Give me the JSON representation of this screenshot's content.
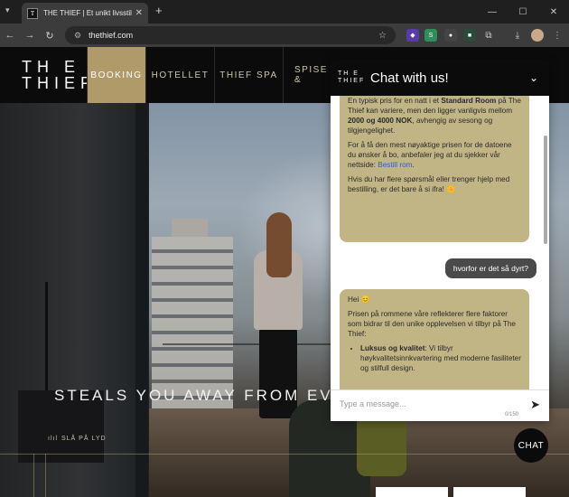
{
  "browser": {
    "tab_title": "THE THIEF | Et unikt livsstilshotell",
    "favicon": "T",
    "url": "thethief.com",
    "new_tab": "+",
    "window_min": "—",
    "window_max": "☐",
    "window_close": "✕"
  },
  "site": {
    "logo_line1": "TH E",
    "logo_line2": "THIEF",
    "nav": [
      "BOOKING",
      "HOTELLET",
      "THIEF SPA",
      "SPISE &"
    ],
    "tagline": "STEALS YOU AWAY FROM EVE",
    "sound_label": "SLÅ PÅ LYD"
  },
  "chat": {
    "logo_line1": "TH E",
    "logo_line2": "THIEF",
    "title": "Chat with us!",
    "bot_msg1_p1_pre": "En typisk pris for en natt i et ",
    "bot_msg1_p1_bold1": "Standard Room",
    "bot_msg1_p1_mid": " på The Thief kan variere, men den ligger vanligvis mellom ",
    "bot_msg1_p1_bold2": "2000 og 4000 NOK",
    "bot_msg1_p1_post": ", avhengig av sesong og tilgjengelighet.",
    "bot_msg1_p2_pre": "For å få den mest nøyaktige prisen for de datoene du ønsker å bo, anbefaler jeg at du sjekker vår nettside: ",
    "bot_msg1_p2_link": "Bestill rom",
    "bot_msg1_p2_post": ".",
    "bot_msg1_p3": "Hvis du har flere spørsmål eller trenger hjelp med bestilling, er det bare å si ifra! 🌼",
    "user_msg": "hvorfor er det så dyrt?",
    "bot_msg2_p1": "Hei 😊",
    "bot_msg2_p2": "Prisen på rommene våre reflekterer flere faktorer som bidrar til den unike opplevelsen vi tilbyr på The Thief:",
    "bot_msg2_li1_bold": "Luksus og kvalitet",
    "bot_msg2_li1_text": ": Vi tilbyr høykvalitetsinnkvartering med moderne fasiliteter og stilfull design.",
    "input_placeholder": "Type a message...",
    "char_count": "0/150",
    "chat_button": "CHAT"
  },
  "colors": {
    "gold": "#b09a6a",
    "bot_bubble": "#c2b585",
    "user_bubble": "#4a4a4a"
  }
}
